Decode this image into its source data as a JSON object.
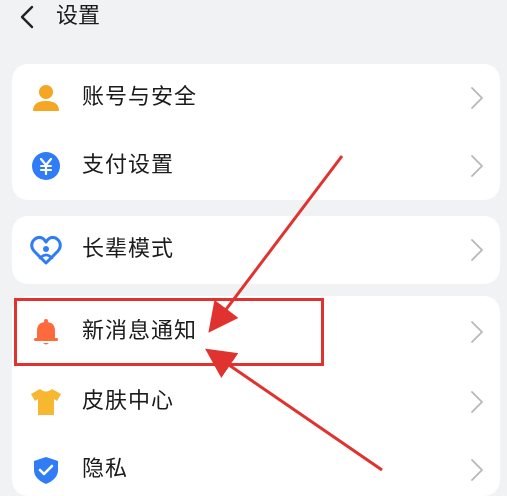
{
  "header": {
    "title": "设置",
    "back_icon": "chevron-left-icon"
  },
  "colors": {
    "background": "#f1f2f4",
    "card": "#ffffff",
    "account_icon": "#f5a623",
    "payment_icon": "#2f7cf6",
    "elder_icon": "#2f7cf6",
    "notification_icon": "#ff6a3d",
    "skin_icon": "#f7b731",
    "privacy_icon": "#2f7cf6",
    "annotation": "#e0322e"
  },
  "groups": [
    {
      "items": [
        {
          "label": "账号与安全",
          "icon": "user-icon"
        },
        {
          "label": "支付设置",
          "icon": "yuan-icon"
        }
      ]
    },
    {
      "items": [
        {
          "label": "长辈模式",
          "icon": "heart-person-icon"
        }
      ]
    },
    {
      "items": [
        {
          "label": "新消息通知",
          "icon": "bell-icon"
        },
        {
          "label": "皮肤中心",
          "icon": "tshirt-icon"
        },
        {
          "label": "隐私",
          "icon": "shield-check-icon"
        }
      ]
    }
  ]
}
